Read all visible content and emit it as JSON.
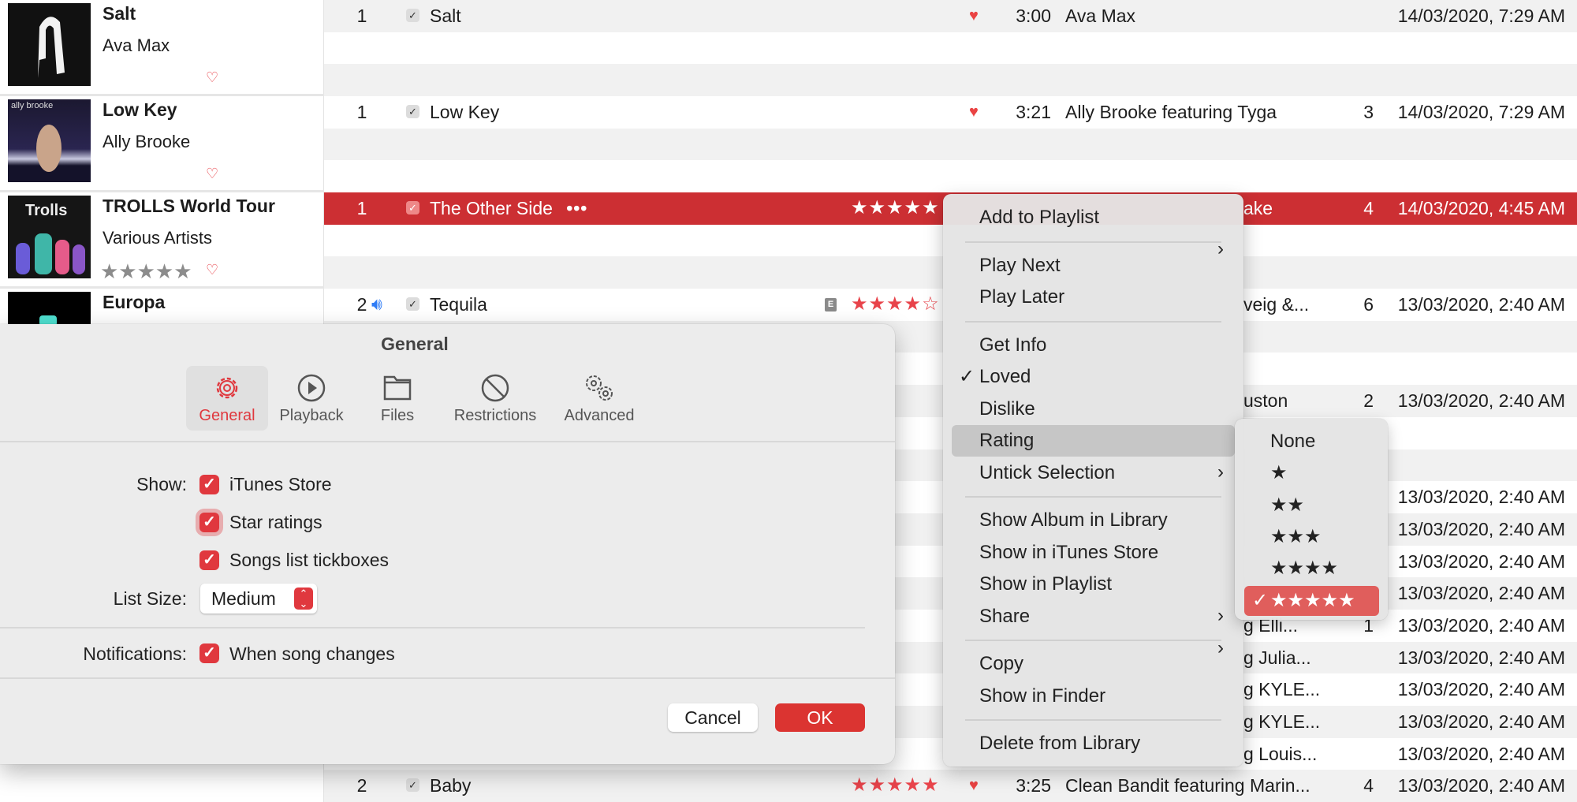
{
  "colors": {
    "accent": "#e0383e",
    "selected_row": "#cc2f33",
    "star": "#e8434a",
    "heart": "#ea4343"
  },
  "albums": [
    {
      "title": "Salt",
      "artist": "Ava Max",
      "loved_icon": "heart-outline-icon"
    },
    {
      "title": "Low Key",
      "artist": "Ally Brooke",
      "loved_icon": "heart-outline-icon",
      "art_text": "ally brooke"
    },
    {
      "title": "TROLLS World Tour",
      "artist": "Various Artists",
      "rating_placeholder": "★★★★★",
      "loved_icon": "heart-outline-icon",
      "art_text": "Trolls"
    },
    {
      "title": "Europa",
      "artist": ""
    }
  ],
  "rows": [
    {
      "num": "1",
      "checked": true,
      "title": "Salt",
      "loved": true,
      "time": "3:00",
      "artist": "Ava Max",
      "date": "14/03/2020, 7:29 AM"
    },
    {},
    {},
    {
      "num": "1",
      "checked": true,
      "title": "Low Key",
      "loved": true,
      "time": "3:21",
      "artist": "Ally Brooke featuring Tyga",
      "plays": "3",
      "date": "14/03/2020, 7:29 AM"
    },
    {},
    {},
    {
      "num": "1",
      "checked": true,
      "title": "The Other Side",
      "more": "•••",
      "rating": 5,
      "selected": true,
      "artist_fragment": "ake",
      "plays": "4",
      "date": "14/03/2020, 4:45 AM"
    },
    {},
    {},
    {
      "num": "2",
      "playing": true,
      "checked": true,
      "title": "Tequila",
      "explicit": "E",
      "rating": 4,
      "artist_fragment": "veig &...",
      "plays": "6",
      "date": "13/03/2020, 2:40 AM"
    },
    {},
    {},
    {
      "artist_fragment": "uston",
      "plays": "2",
      "date": "13/03/2020, 2:40 AM"
    },
    {},
    {},
    {
      "date": "13/03/2020, 2:40 AM"
    },
    {
      "date": "13/03/2020, 2:40 AM"
    },
    {
      "date": "13/03/2020, 2:40 AM"
    },
    {
      "date": "13/03/2020, 2:40 AM"
    },
    {
      "artist_fragment": "g Elli...",
      "plays": "1",
      "date": "13/03/2020, 2:40 AM"
    },
    {
      "artist_fragment": "g Julia...",
      "date": "13/03/2020, 2:40 AM"
    },
    {
      "artist_fragment": "g KYLE...",
      "date": "13/03/2020, 2:40 AM"
    },
    {
      "artist_fragment": "g KYLE...",
      "date": "13/03/2020, 2:40 AM"
    },
    {
      "artist_fragment": "g Louis...",
      "date": "13/03/2020, 2:40 AM"
    },
    {
      "num": "2",
      "checked": true,
      "title": "Baby",
      "rating": 5,
      "loved": true,
      "time": "3:25",
      "artist": "Clean Bandit featuring Marin...",
      "plays": "4",
      "date": "13/03/2020, 2:40 AM"
    }
  ],
  "dialog": {
    "title": "General",
    "tabs": [
      {
        "label": "General",
        "active": true
      },
      {
        "label": "Playback"
      },
      {
        "label": "Files"
      },
      {
        "label": "Restrictions"
      },
      {
        "label": "Advanced"
      }
    ],
    "show_label": "Show:",
    "show_options": [
      {
        "label": "iTunes Store",
        "checked": true
      },
      {
        "label": "Star ratings",
        "checked": true
      },
      {
        "label": "Songs list tickboxes",
        "checked": true
      }
    ],
    "list_size_label": "List Size:",
    "list_size_value": "Medium",
    "notifications_label": "Notifications:",
    "notifications_option": {
      "label": "When song changes",
      "checked": true
    },
    "cancel": "Cancel",
    "ok": "OK"
  },
  "context_menu": [
    {
      "label": "Add to Playlist",
      "submenu": true
    },
    {
      "sep": true
    },
    {
      "label": "Play Next"
    },
    {
      "label": "Play Later"
    },
    {
      "sep": true
    },
    {
      "label": "Get Info"
    },
    {
      "label": "Loved",
      "checked": true
    },
    {
      "label": "Dislike"
    },
    {
      "label": "Rating",
      "submenu": true,
      "highlighted": true
    },
    {
      "label": "Untick Selection"
    },
    {
      "sep": true
    },
    {
      "label": "Show Album in Library"
    },
    {
      "label": "Show in iTunes Store"
    },
    {
      "label": "Show in Playlist",
      "submenu": true
    },
    {
      "label": "Share",
      "submenu": true
    },
    {
      "sep": true
    },
    {
      "label": "Copy"
    },
    {
      "label": "Show in Finder"
    },
    {
      "sep": true
    },
    {
      "label": "Delete from Library"
    }
  ],
  "rating_submenu": [
    {
      "label": "None"
    },
    {
      "label": "★"
    },
    {
      "label": "★★"
    },
    {
      "label": "★★★"
    },
    {
      "label": "★★★★"
    },
    {
      "label": "★★★★★",
      "checked": true
    }
  ]
}
